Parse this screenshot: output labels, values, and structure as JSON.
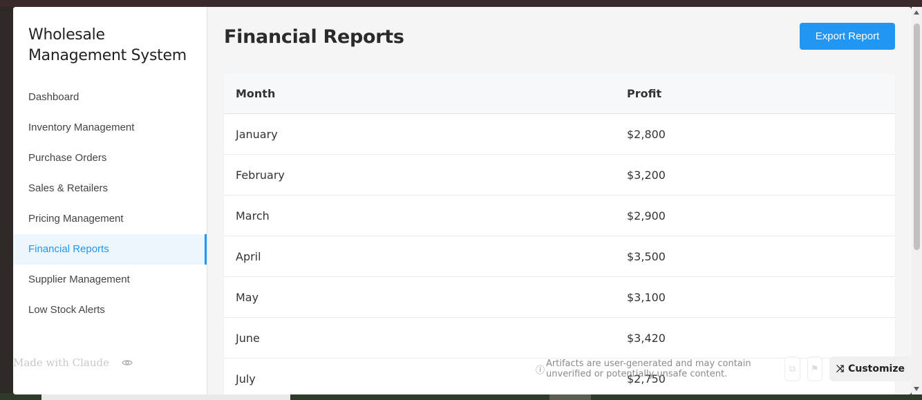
{
  "sidebar": {
    "title_line1": "Wholesale",
    "title_line2": "Management System",
    "items": [
      {
        "label": "Dashboard"
      },
      {
        "label": "Inventory Management"
      },
      {
        "label": "Purchase Orders"
      },
      {
        "label": "Sales & Retailers"
      },
      {
        "label": "Pricing Management"
      },
      {
        "label": "Financial Reports",
        "active": true
      },
      {
        "label": "Supplier Management"
      },
      {
        "label": "Low Stock Alerts"
      }
    ],
    "made_with": "Made with Claude"
  },
  "header": {
    "title": "Financial Reports",
    "export_label": "Export Report"
  },
  "table": {
    "columns": [
      "Month",
      "Profit"
    ],
    "rows": [
      [
        "January",
        "$2,800"
      ],
      [
        "February",
        "$3,200"
      ],
      [
        "March",
        "$2,900"
      ],
      [
        "April",
        "$3,500"
      ],
      [
        "May",
        "$3,100"
      ],
      [
        "June",
        "$3,420"
      ],
      [
        "July",
        "$2,750"
      ]
    ]
  },
  "footer": {
    "notice": "Artifacts are user-generated and may contain unverified or potentially unsafe content.",
    "customize_label": "Customize"
  },
  "colors": {
    "accent": "#2196f3",
    "active_bg": "#eef6fd"
  }
}
